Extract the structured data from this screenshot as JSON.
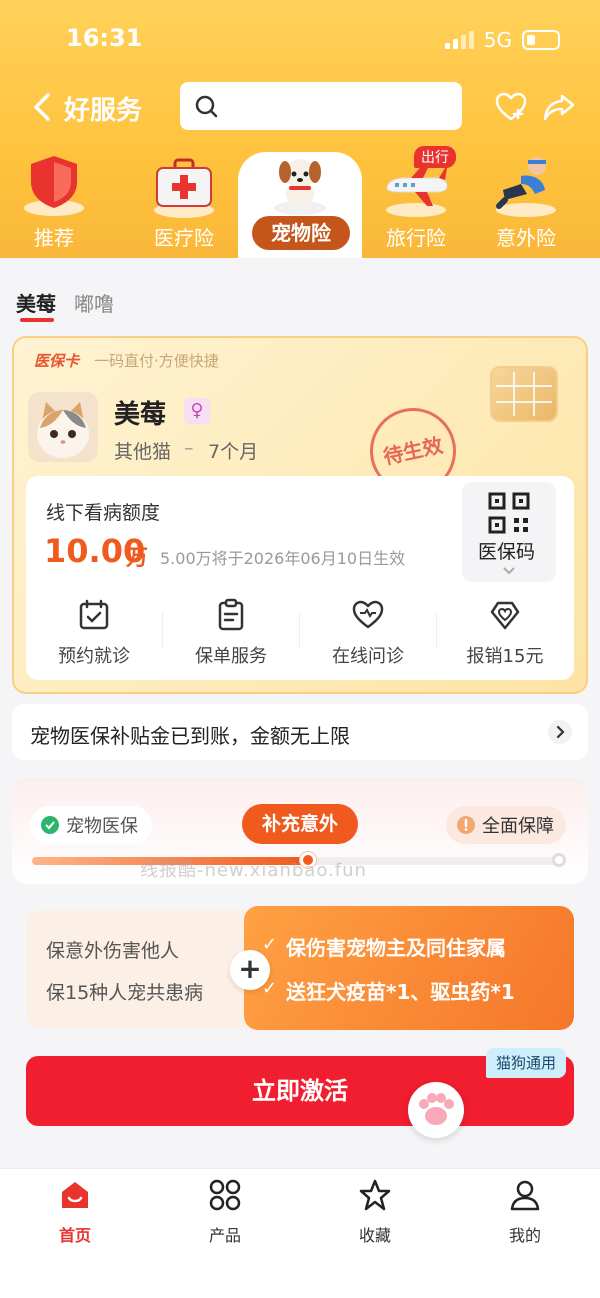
{
  "status_bar": {
    "time": "16:31",
    "network": "5G"
  },
  "nav": {
    "title": "好服务",
    "search_placeholder": ""
  },
  "categories": [
    {
      "label": "推荐",
      "icon": "shield-icon"
    },
    {
      "label": "医疗险",
      "icon": "first-aid-kit-icon"
    },
    {
      "label": "宠物险",
      "icon": "puppy-icon",
      "active": true
    },
    {
      "label": "旅行险",
      "icon": "airplane-icon",
      "badge": "出行"
    },
    {
      "label": "意外险",
      "icon": "injured-person-icon"
    }
  ],
  "pet_tabs": [
    {
      "label": "美莓",
      "active": true
    },
    {
      "label": "嘟噜"
    }
  ],
  "card": {
    "brand": "医保卡",
    "slogan": "一码直付·方便快捷",
    "pet_name": "美莓",
    "gender_symbol": "♀",
    "pet_type": "其他猫",
    "dash": "–",
    "pet_age": "7个月",
    "stamp": "待生效",
    "quota_label": "线下看病额度",
    "quota_value": "10.00",
    "quota_unit": "万",
    "quota_note": "5.00万将于2026年06月10日生效",
    "qr_label": "医保码",
    "actions": [
      {
        "label": "预约就诊",
        "icon": "calendar-check-icon"
      },
      {
        "label": "保单服务",
        "icon": "clipboard-icon"
      },
      {
        "label": "在线问诊",
        "icon": "heart-icon"
      },
      {
        "label": "报销15元",
        "icon": "heart-diamond-icon"
      }
    ]
  },
  "notice": {
    "text": "宠物医保补贴金已到账，金额无上限"
  },
  "progress": {
    "steps": [
      "宠物医保",
      "补充意外",
      "全面保障"
    ],
    "current_step": 2,
    "fill_fraction": 0.52,
    "watermark": "线报酷-new.xianbao.fun"
  },
  "benefits": {
    "left": [
      "保意外伤害他人",
      "保15种人宠共患病"
    ],
    "plus": "+",
    "check": "✓",
    "right": [
      "保伤害宠物主及同住家属",
      "送狂犬疫苗*1、驱虫药*1"
    ]
  },
  "cta": {
    "label": "立即激活",
    "tag": "猫狗通用"
  },
  "tabbar": [
    {
      "label": "首页",
      "icon": "home-icon",
      "active": true
    },
    {
      "label": "产品",
      "icon": "grid-icon"
    },
    {
      "label": "收藏",
      "icon": "star-icon"
    },
    {
      "label": "我的",
      "icon": "user-icon"
    }
  ],
  "colors": {
    "primary": "#f11e2f",
    "orange": "#f05a1e",
    "header": "#ffc23d"
  }
}
